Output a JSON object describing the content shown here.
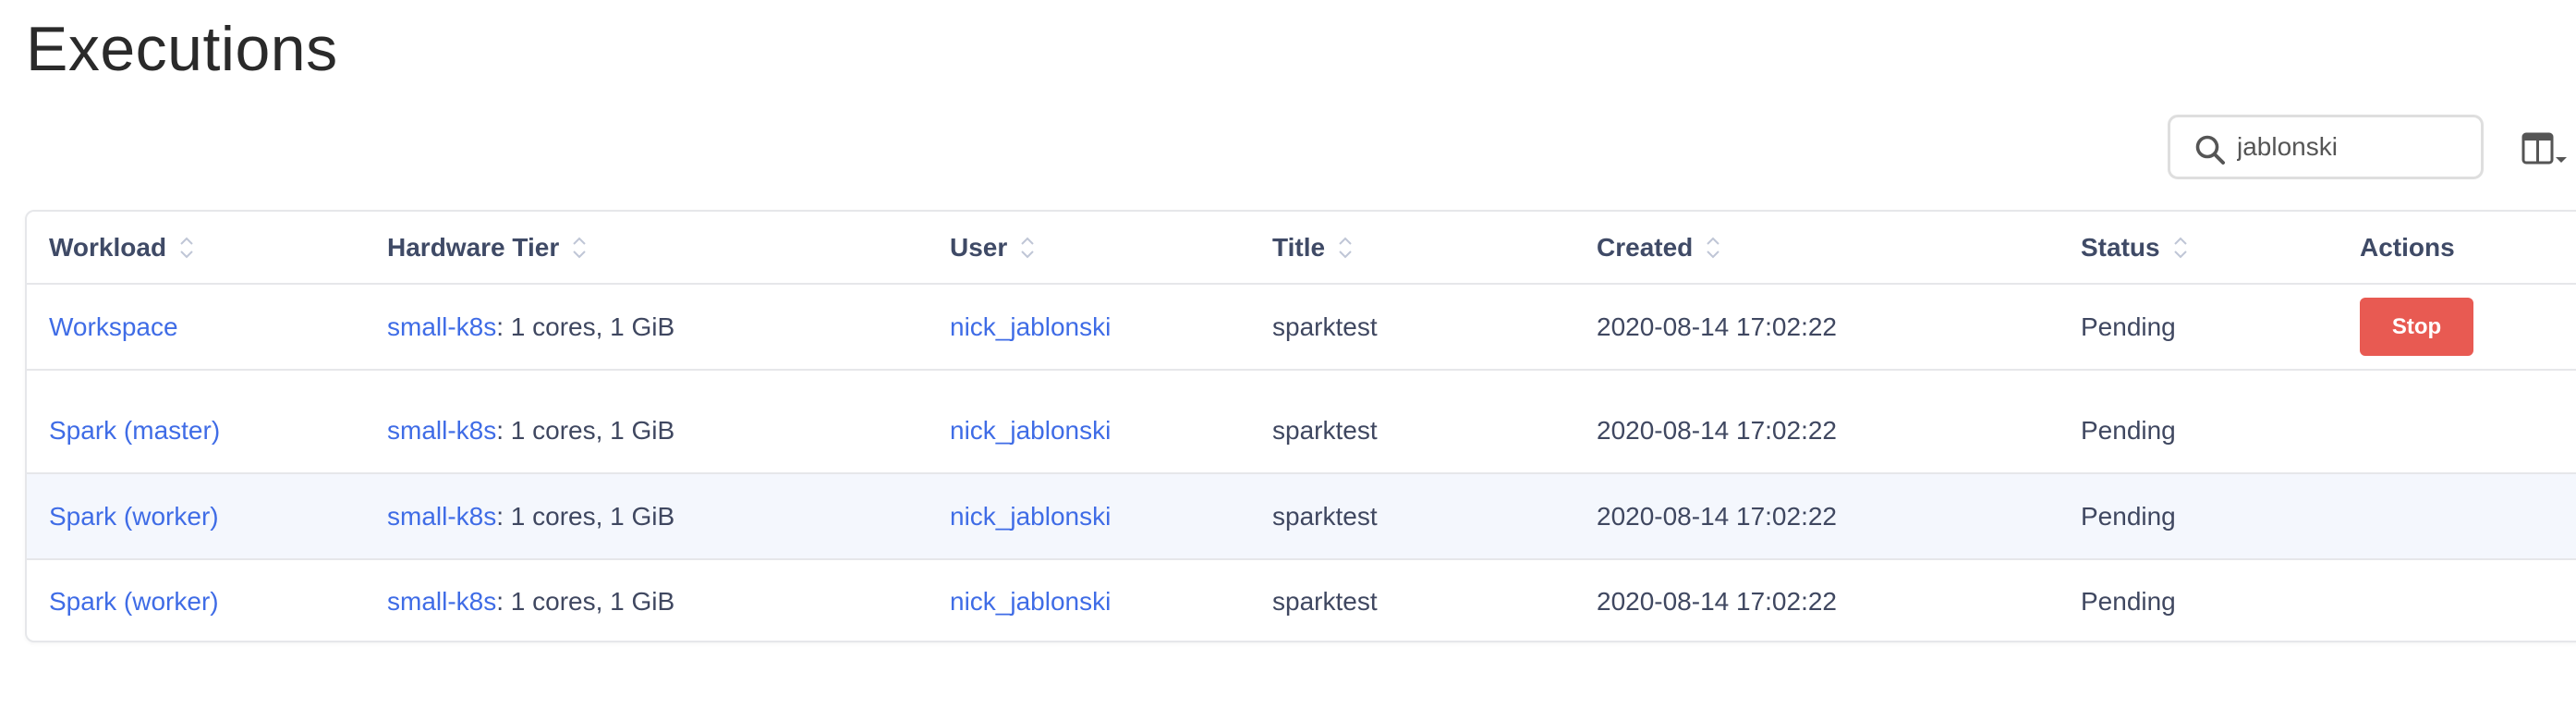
{
  "page": {
    "title": "Executions"
  },
  "toolbar": {
    "search": {
      "value": "jablonski",
      "icon": "search-icon"
    },
    "columns_button": {
      "icon": "columns-icon"
    }
  },
  "table": {
    "columns": [
      {
        "key": "workload",
        "label": "Workload",
        "sortable": true
      },
      {
        "key": "hardware_tier",
        "label": "Hardware Tier",
        "sortable": true
      },
      {
        "key": "user",
        "label": "User",
        "sortable": true
      },
      {
        "key": "title",
        "label": "Title",
        "sortable": true
      },
      {
        "key": "created",
        "label": "Created",
        "sortable": true
      },
      {
        "key": "status",
        "label": "Status",
        "sortable": true
      },
      {
        "key": "actions",
        "label": "Actions",
        "sortable": false
      }
    ],
    "rows": [
      {
        "workload": "Workspace",
        "hardware_tier_name": "small-k8s",
        "hardware_tier_spec": ": 1 cores, 1 GiB",
        "user": "nick_jablonski",
        "title": "sparktest",
        "created": "2020-08-14 17:02:22",
        "status": "Pending",
        "action_label": "Stop"
      },
      {
        "workload": "Spark (master)",
        "hardware_tier_name": "small-k8s",
        "hardware_tier_spec": ": 1 cores, 1 GiB",
        "user": "nick_jablonski",
        "title": "sparktest",
        "created": "2020-08-14 17:02:22",
        "status": "Pending"
      },
      {
        "workload": "Spark (worker)",
        "hardware_tier_name": "small-k8s",
        "hardware_tier_spec": ": 1 cores, 1 GiB",
        "user": "nick_jablonski",
        "title": "sparktest",
        "created": "2020-08-14 17:02:22",
        "status": "Pending"
      },
      {
        "workload": "Spark (worker)",
        "hardware_tier_name": "small-k8s",
        "hardware_tier_spec": ": 1 cores, 1 GiB",
        "user": "nick_jablonski",
        "title": "sparktest",
        "created": "2020-08-14 17:02:22",
        "status": "Pending"
      }
    ]
  },
  "colors": {
    "link": "#3f6ce6",
    "stop_button": "#e85a52",
    "header_text": "#3f4a66",
    "body_text": "#3f4760",
    "highlight_row": "#f4f7fd"
  }
}
